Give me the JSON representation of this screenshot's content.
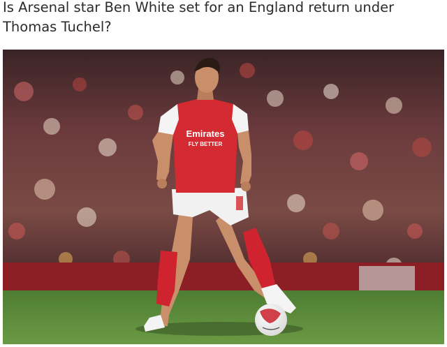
{
  "article": {
    "headline": "Is Arsenal star Ben White set for an England return under Thomas Tuchel?"
  },
  "photo": {
    "kit_sponsor_line1": "Emirates",
    "kit_sponsor_line2": "FLY BETTER",
    "colors": {
      "shirt_red": "#d42a32",
      "sleeve_white": "#f4f4f4",
      "shorts_white": "#f1f1f1",
      "socks_red": "#cf2330",
      "pitch_green": "#5e8a3c",
      "skin": "#c98f6a"
    }
  }
}
